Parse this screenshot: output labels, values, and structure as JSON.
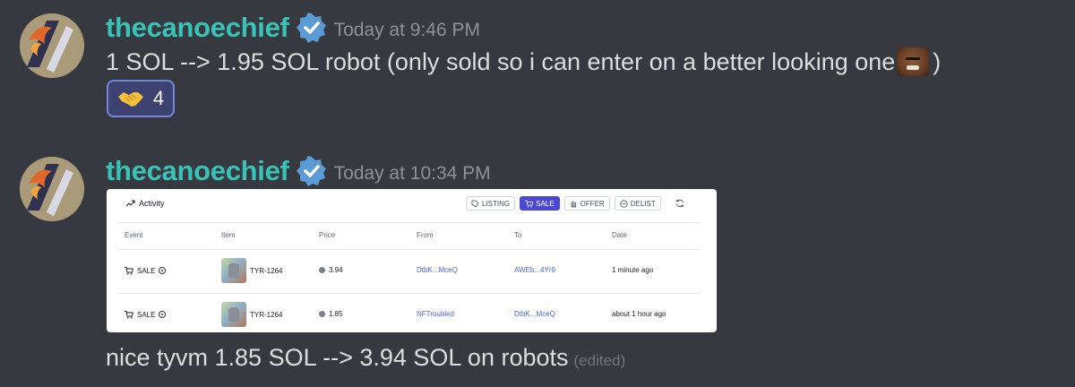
{
  "messages": [
    {
      "username": "thecanoechief",
      "timestamp": "Today at 9:46 PM",
      "content_before_emoji": "1 SOL --> 1.95 SOL robot (only sold so i can enter on a better looking one",
      "content_after_emoji": ")",
      "emoji": "face-emoji",
      "reaction": {
        "icon": "handshake-icon",
        "count": "4"
      }
    },
    {
      "username": "thecanoechief",
      "timestamp": "Today at 10:34 PM",
      "content": "nice tyvm 1.85 SOL --> 3.94 SOL on robots",
      "edited": "(edited)"
    }
  ],
  "embed": {
    "title": "Activity",
    "filters": [
      {
        "label": "LISTING",
        "icon": "tag-icon",
        "active": false
      },
      {
        "label": "SALE",
        "icon": "cart-icon",
        "active": true
      },
      {
        "label": "OFFER",
        "icon": "hand-icon",
        "active": false
      },
      {
        "label": "DELIST",
        "icon": "minus-circle-icon",
        "active": false
      }
    ],
    "columns": [
      "Event",
      "Item",
      "Price",
      "From",
      "To",
      "Date"
    ],
    "rows": [
      {
        "event": "SALE",
        "item": "TYR-1264",
        "price": "3.94",
        "from": "DtbK...MceQ",
        "to": "AWEb...4Yr9",
        "date": "1 minute ago"
      },
      {
        "event": "SALE",
        "item": "TYR-1264",
        "price": "1.85",
        "from": "NFTroubled",
        "to": "DtbK...MceQ",
        "date": "about 1 hour ago"
      }
    ]
  },
  "colors": {
    "background": "#36393f",
    "username": "#38c3b6",
    "verified": "#5b9bd5",
    "reaction_border": "#7289da",
    "sale_button": "#4b49d3",
    "link": "#4b63d8"
  }
}
